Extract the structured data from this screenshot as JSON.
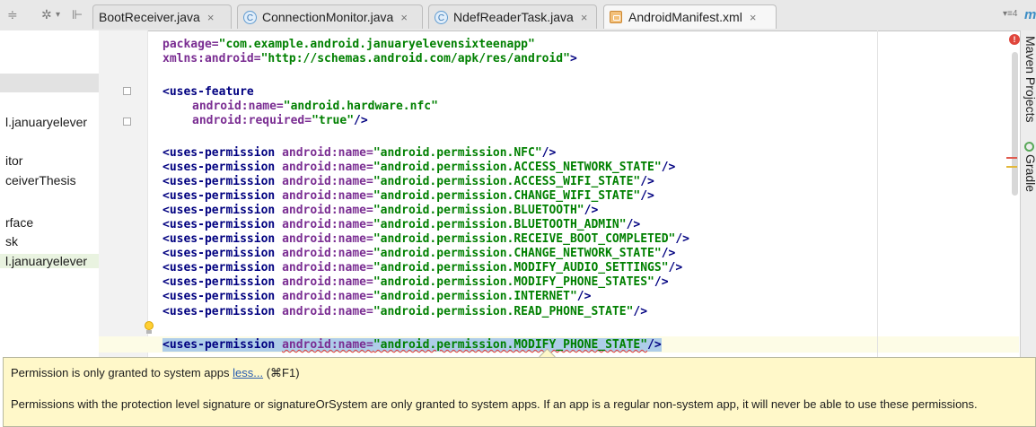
{
  "tabs": [
    {
      "label": "BootReceiver.java",
      "icon": "class-icon",
      "active": false
    },
    {
      "label": "ConnectionMonitor.java",
      "icon": "class-icon",
      "active": false
    },
    {
      "label": "NdefReaderTask.java",
      "icon": "class-icon",
      "active": false
    },
    {
      "label": "AndroidManifest.xml",
      "icon": "xml-file-icon",
      "active": true
    }
  ],
  "tab_icon_letter": "C",
  "close_glyph": "×",
  "tab_overflow": "▾≡4",
  "maven_logo": "m",
  "project_tree": [
    "l.januaryelever",
    "itor",
    "ceiverThesis",
    "rface",
    "sk",
    "l.januaryelever"
  ],
  "code_lines": {
    "l1": {
      "attr": "package=",
      "val": "\"com.example.android.januaryelevensixteenapp\""
    },
    "l2": {
      "attr": "xmlns:android=",
      "val": "\"http://schemas.android.com/apk/res/android\"",
      "end": ">"
    },
    "l3": {
      "tag": "<uses-feature"
    },
    "l4": {
      "attr": "android:name=",
      "val": "\"android.hardware.nfc\""
    },
    "l5": {
      "attr": "android:required=",
      "val": "\"true\"",
      "end": "/>"
    }
  },
  "perm_tag": "<uses-permission",
  "perm_attr": "android:name=",
  "perm_close": "/>",
  "permissions": [
    "\"android.permission.NFC\"",
    "\"android.permission.ACCESS_NETWORK_STATE\"",
    "\"android.permission.ACCESS_WIFI_STATE\"",
    "\"android.permission.CHANGE_WIFI_STATE\"",
    "\"android.permission.BLUETOOTH\"",
    "\"android.permission.BLUETOOTH_ADMIN\"",
    "\"android.permission.RECEIVE_BOOT_COMPLETED\"",
    "\"android.permission.CHANGE_NETWORK_STATE\"",
    "\"android.permission.MODIFY_AUDIO_SETTINGS\"",
    "\"android.permission.MODIFY_PHONE_STATES\"",
    "\"android.permission.INTERNET\"",
    "\"android.permission.READ_PHONE_STATE\"",
    "\"android.permission.MODIFY_PHONE_STATE\""
  ],
  "right_tools": {
    "maven": "Maven Projects",
    "gradle": "Gradle"
  },
  "error_badge": "!",
  "tooltip": {
    "summary": "Permission is only granted to system apps",
    "link": "less...",
    "shortcut": "(⌘F1)",
    "body": "Permissions with the protection level signature or signatureOrSystem are only granted to system apps. If an app is a regular non-system app, it will never be able to use these permissions."
  },
  "colors": {
    "tag": "#000080",
    "attribute": "#7a2d92",
    "value": "#008000",
    "selection": "#aecde9",
    "tooltip_bg": "#fff8c9",
    "link": "#2a5db0"
  }
}
